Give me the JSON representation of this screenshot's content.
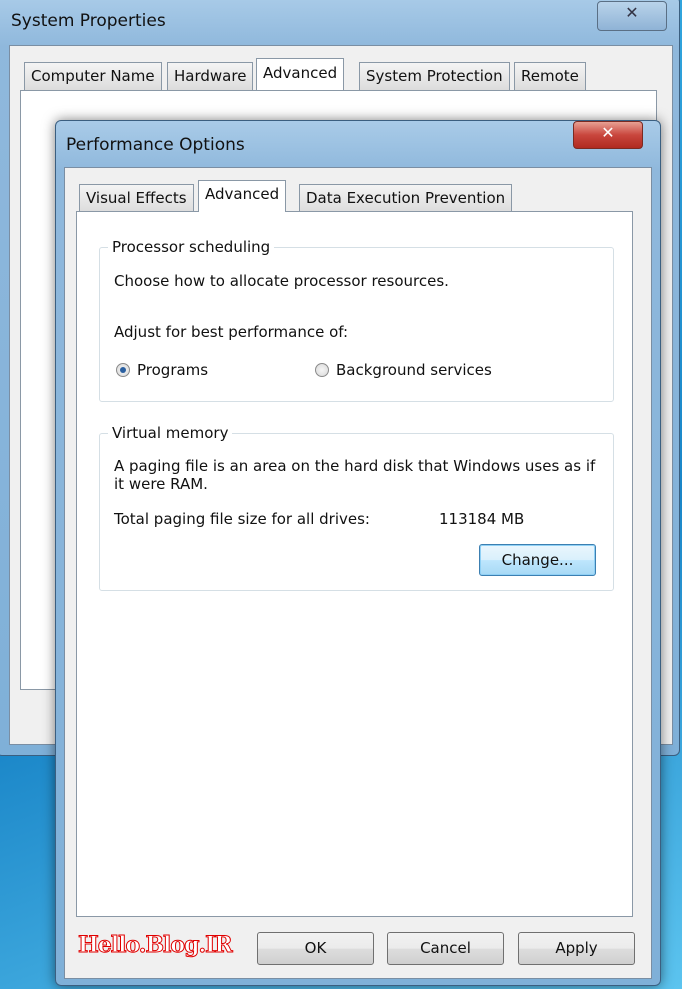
{
  "system_properties": {
    "title": "System Properties",
    "tabs": [
      {
        "label": "Computer Name"
      },
      {
        "label": "Hardware"
      },
      {
        "label": "Advanced",
        "selected": true
      },
      {
        "label": "System Protection"
      },
      {
        "label": "Remote"
      }
    ]
  },
  "performance_options": {
    "title": "Performance Options",
    "tabs": [
      {
        "label": "Visual Effects"
      },
      {
        "label": "Advanced",
        "selected": true
      },
      {
        "label": "Data Execution Prevention"
      }
    ],
    "processor_scheduling": {
      "label": "Processor scheduling",
      "description": "Choose how to allocate processor resources.",
      "adjust_label": "Adjust for best performance of:",
      "options": [
        {
          "label": "Programs",
          "checked": true
        },
        {
          "label": "Background services",
          "checked": false
        }
      ]
    },
    "virtual_memory": {
      "label": "Virtual memory",
      "description": "A paging file is an area on the hard disk that Windows uses as if it were RAM.",
      "total_label": "Total paging file size for all drives:",
      "total_value": "113184 MB",
      "change_button": "Change..."
    },
    "buttons": {
      "ok": "OK",
      "cancel": "Cancel",
      "apply": "Apply"
    }
  },
  "watermark": "Hello.Blog.IR",
  "colors": {
    "close_red": "#c9463d",
    "watermark_red": "#e00000",
    "desktop_blue": "#1a86c8"
  }
}
